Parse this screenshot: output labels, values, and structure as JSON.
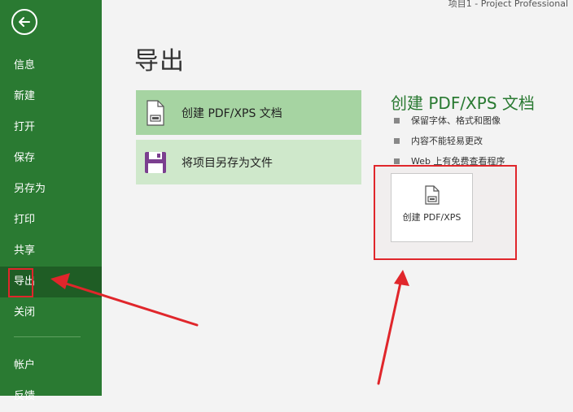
{
  "window": {
    "title": "项目1  -  Project Professional"
  },
  "sidebar": {
    "items": [
      {
        "label": "信息"
      },
      {
        "label": "新建"
      },
      {
        "label": "打开"
      },
      {
        "label": "保存"
      },
      {
        "label": "另存为"
      },
      {
        "label": "打印"
      },
      {
        "label": "共享"
      },
      {
        "label": "导出"
      },
      {
        "label": "关闭"
      }
    ],
    "bottom_items": [
      {
        "label": "帐户"
      },
      {
        "label": "反馈"
      }
    ]
  },
  "main": {
    "title": "导出",
    "options": [
      {
        "label": "创建 PDF/XPS 文档",
        "icon": "pdf-document-icon"
      },
      {
        "label": "将项目另存为文件",
        "icon": "save-disk-icon"
      }
    ]
  },
  "detail": {
    "title": "创建 PDF/XPS 文档",
    "bullets": [
      "保留字体、格式和图像",
      "内容不能轻易更改",
      "Web 上有免费查看程序"
    ],
    "button_label": "创建 PDF/XPS"
  },
  "colors": {
    "brand": "#2a7a32",
    "annotation": "#e0262b"
  }
}
